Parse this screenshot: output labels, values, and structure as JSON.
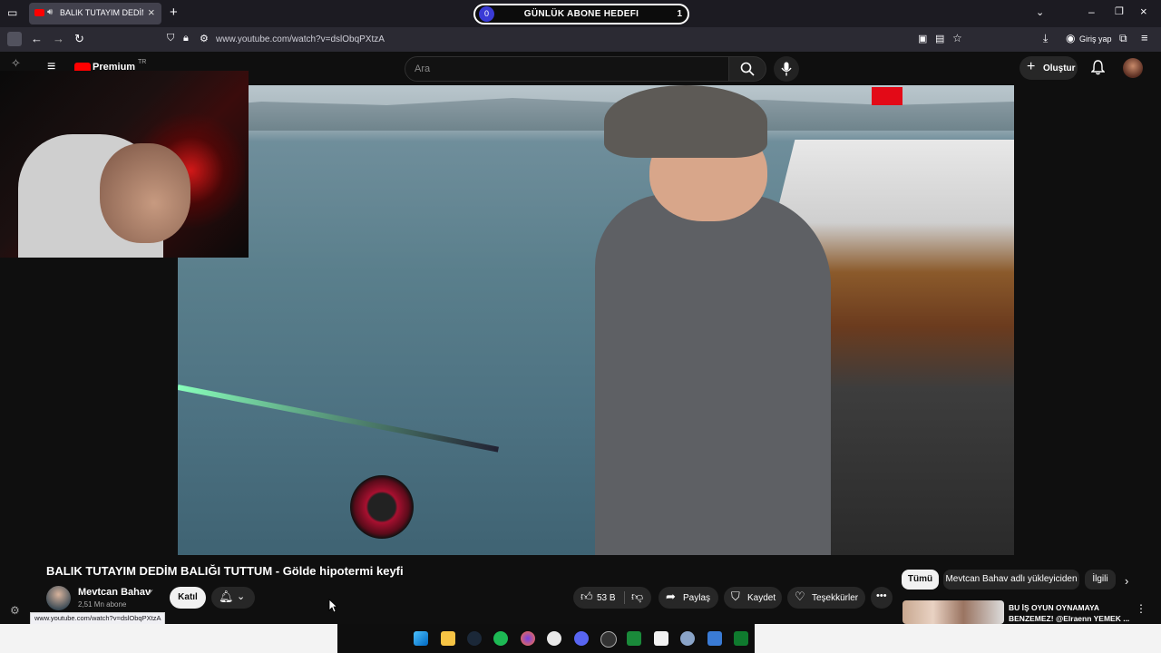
{
  "browser": {
    "tab_title": "BALIK TUTAYIM DEDİM BALI",
    "url": "www.youtube.com/watch?v=dslObqPXtzA",
    "login_label": "Giriş yap"
  },
  "overlay_goal": {
    "left_count": "0",
    "label": "GÜNLÜK ABONE HEDEFI",
    "right_count": "1"
  },
  "youtube_header": {
    "logo_text": "Premium",
    "logo_sup": "TR",
    "search_placeholder": "Ara",
    "create_label": "Oluştur"
  },
  "video": {
    "title": "BALIK TUTAYIM DEDİM BALIĞI TUTTUM - Gölde hipotermi keyfi",
    "channel_name": "Mevtcan Bahav",
    "subscribers": "2,51 Mn abone",
    "join_label": "Katıl",
    "likes": "53 B",
    "share_label": "Paylaş",
    "save_label": "Kaydet",
    "thanks_label": "Teşekkürler"
  },
  "sidebar": {
    "chips": [
      "Tümü",
      "Mevtcan Bahav adlı yükleyiciden",
      "İlgili"
    ],
    "recommendation_title": "BU İŞ OYUN OYNAMAYA BENZEMEZ! @Elraenn YEMEK ..."
  },
  "status_url": "www.youtube.com/watch?v=dslObqPXtzA",
  "taskbar_icons": [
    "windows-icon",
    "files-icon",
    "steam-icon",
    "spotify-icon",
    "firefox-icon",
    "obs-icon",
    "discord-icon",
    "clock-icon",
    "app-green-icon",
    "capcut-icon",
    "settings-icon",
    "app-blue-icon",
    "app-green2-icon"
  ]
}
